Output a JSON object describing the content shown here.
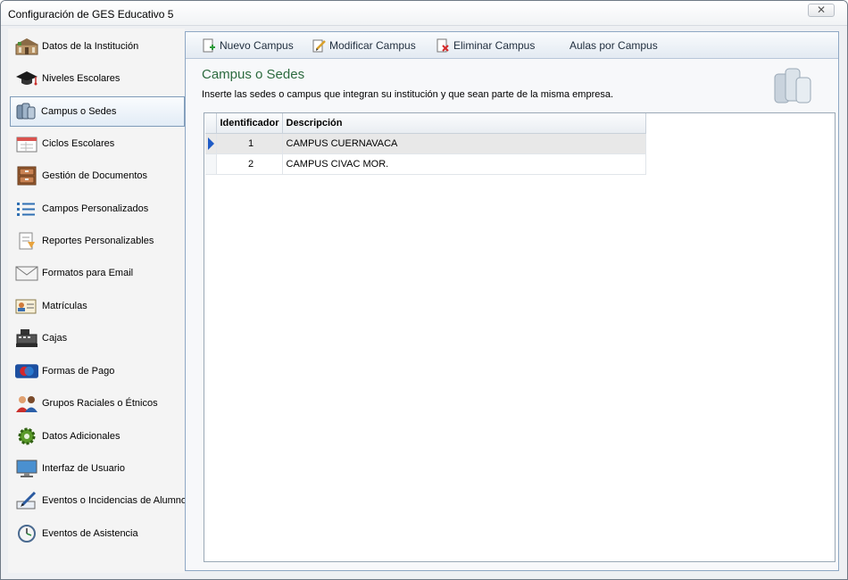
{
  "window": {
    "title": "Configuración de GES Educativo 5",
    "close_glyph": "✕"
  },
  "sidebar": {
    "items": [
      {
        "label": "Datos de la Institución",
        "icon": "building-icon"
      },
      {
        "label": "Niveles Escolares",
        "icon": "graduation-cap-icon"
      },
      {
        "label": "Campus o Sedes",
        "icon": "servers-icon",
        "selected": true
      },
      {
        "label": "Ciclos Escolares",
        "icon": "calendar-icon"
      },
      {
        "label": "Gestión de Documentos",
        "icon": "file-cabinet-icon"
      },
      {
        "label": "Campos Personalizados",
        "icon": "list-icon"
      },
      {
        "label": "Reportes Personalizables",
        "icon": "report-icon"
      },
      {
        "label": "Formatos para Email",
        "icon": "envelope-icon"
      },
      {
        "label": "Matrículas",
        "icon": "id-card-icon"
      },
      {
        "label": "Cajas",
        "icon": "cash-register-icon"
      },
      {
        "label": "Formas de Pago",
        "icon": "maestro-card-icon"
      },
      {
        "label": "Grupos Raciales o Étnicos",
        "icon": "people-icon"
      },
      {
        "label": "Datos Adicionales",
        "icon": "gear-icon"
      },
      {
        "label": "Interfaz de Usuario",
        "icon": "monitor-icon"
      },
      {
        "label": "Eventos o Incidencias de Alumnos",
        "icon": "pen-icon"
      },
      {
        "label": "Eventos de Asistencia",
        "icon": "clock-icon"
      }
    ]
  },
  "toolbar": {
    "new_label": "Nuevo Campus",
    "edit_label": "Modificar Campus",
    "delete_label": "Eliminar Campus",
    "rooms_label": "Aulas por Campus"
  },
  "main": {
    "title": "Campus o Sedes",
    "description": "Inserte las sedes o campus que integran su institución y que sean parte de la misma empresa."
  },
  "grid": {
    "columns": [
      "Identificador",
      "Descripción"
    ],
    "rows": [
      {
        "id": "1",
        "description": "CAMPUS CUERNAVACA",
        "active": true
      },
      {
        "id": "2",
        "description": "CAMPUS CIVAC MOR.",
        "active": false
      }
    ]
  },
  "colors": {
    "title_green": "#2d6b3f",
    "selection_border": "#7f9bb8",
    "row_marker": "#1e5bc6"
  }
}
